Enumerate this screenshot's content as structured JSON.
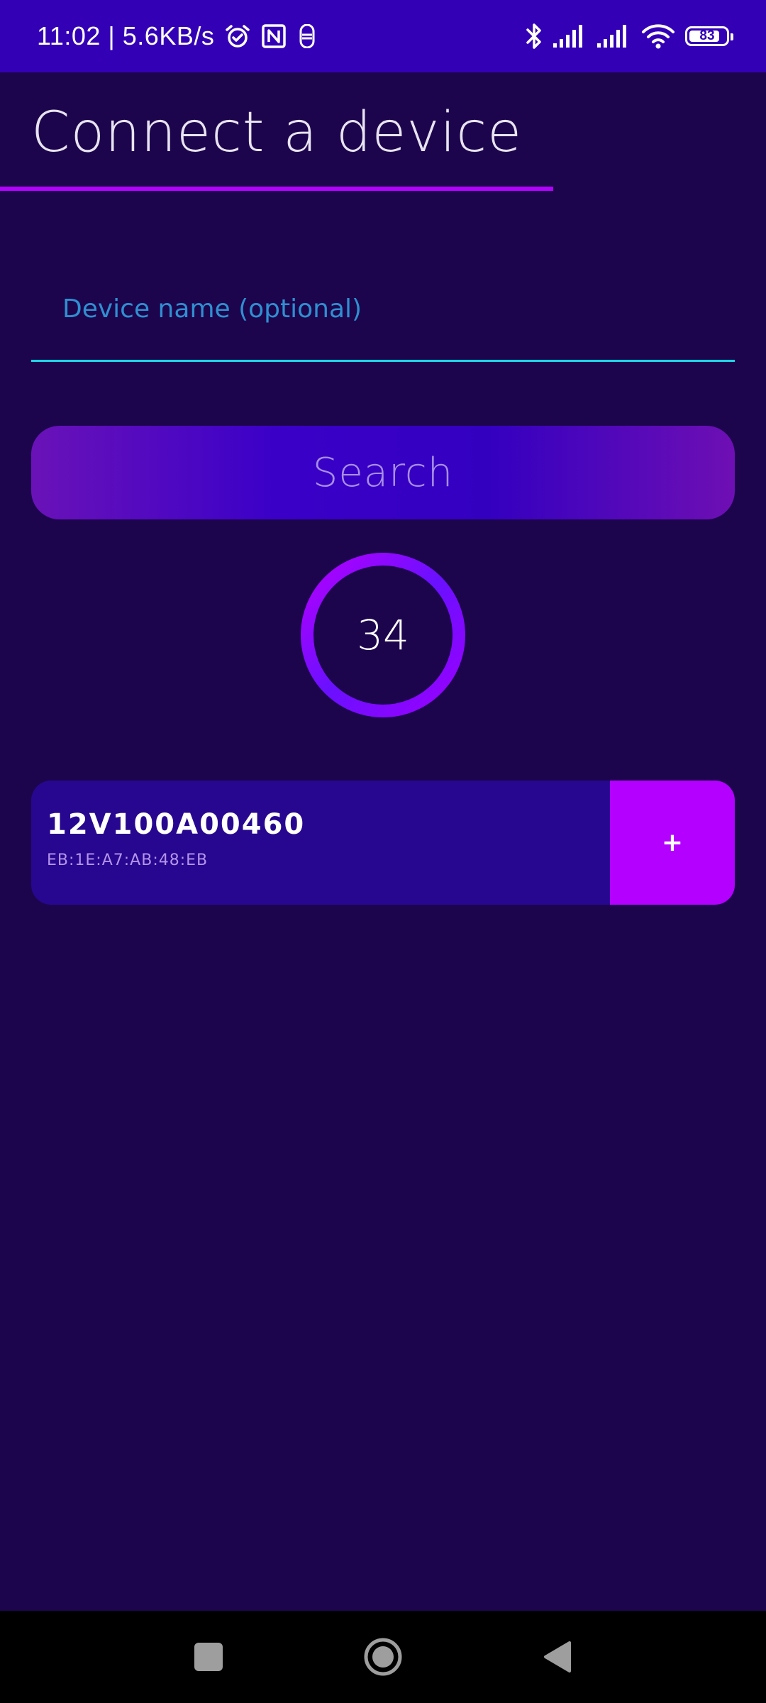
{
  "status_bar": {
    "time_speed": "11:02 | 5.6KB/s",
    "left_icons": [
      "alarm-icon",
      "nfc-icon",
      "notification-icon"
    ],
    "right_icons": [
      "bluetooth-icon",
      "signal-icon",
      "signal-icon",
      "wifi-icon",
      "battery-icon"
    ],
    "battery_level": "83"
  },
  "header": {
    "title": "Connect a device"
  },
  "search_form": {
    "input_value": "",
    "input_placeholder": "Device name (optional)",
    "search_label": "Search"
  },
  "scan_timer": {
    "value": "34"
  },
  "devices": [
    {
      "name": "12V100A00460",
      "mac": "EB:1E:A7:AB:48:EB",
      "add_label": "+"
    }
  ],
  "colors": {
    "background": "#1d054e",
    "status_bar": "#3400b6",
    "accent": "#b400ff",
    "input_line": "#1fd6e6",
    "card": "#27078f"
  },
  "nav_bar": {
    "buttons": [
      "recents-icon",
      "home-icon",
      "back-icon"
    ]
  }
}
